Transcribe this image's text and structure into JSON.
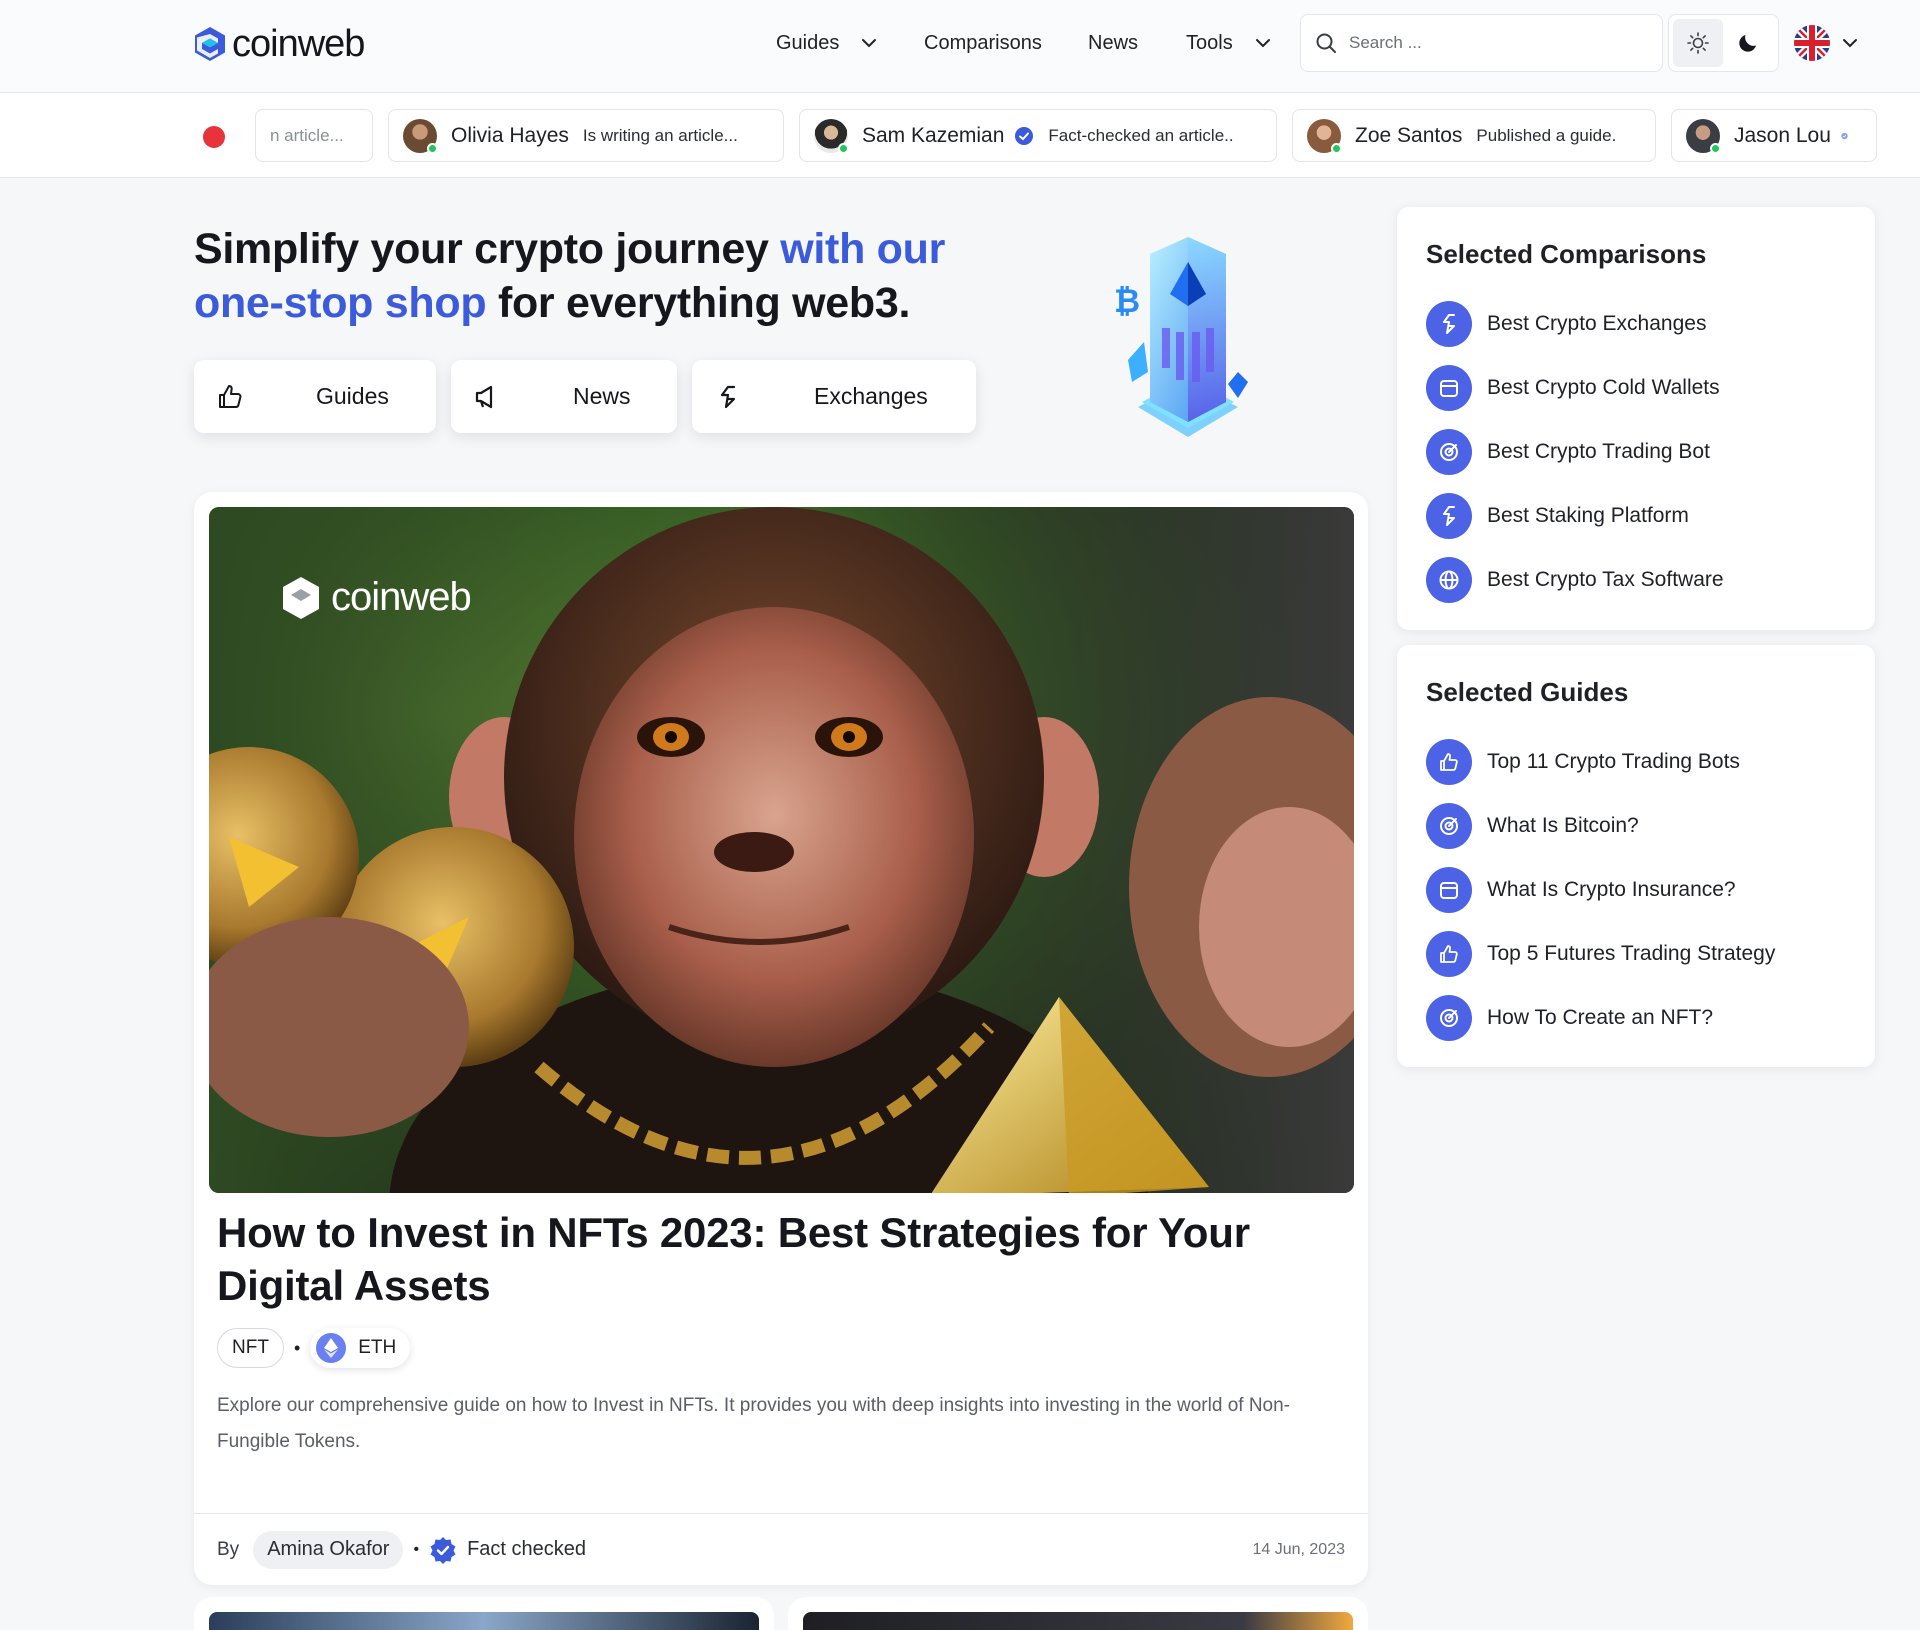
{
  "header": {
    "logo_text": "coinweb",
    "nav": {
      "guides": "Guides",
      "comparisons": "Comparisons",
      "news": "News",
      "tools": "Tools"
    },
    "search_placeholder": "Search ...",
    "theme_active": "light",
    "language_flag": "uk-flag"
  },
  "ticker": {
    "items": [
      {
        "name": "",
        "status": "n article...",
        "fade": true
      },
      {
        "name": "Olivia Hayes",
        "status": "Is writing an article...",
        "verified": false
      },
      {
        "name": "Sam Kazemian",
        "status": "Fact-checked an article..",
        "verified": true
      },
      {
        "name": "Zoe Santos",
        "status": "Published a guide.",
        "verified": false
      },
      {
        "name": "Jason Lou",
        "status": "",
        "verified": true
      }
    ]
  },
  "hero": {
    "title_part1": "Simplify your crypto journey ",
    "title_accent": "with our one-stop shop",
    "title_part2": " for everything web3.",
    "buttons": {
      "guides": "Guides",
      "news": "News",
      "exchanges": "Exchanges"
    }
  },
  "featured": {
    "image_logo_text": "coinweb",
    "title": "How to Invest in NFTs 2023: Best Strategies for Your Digital Assets",
    "tags": [
      "NFT",
      "ETH"
    ],
    "description": "Explore our comprehensive guide on how to Invest in NFTs. It provides you with deep insights into investing in the world of Non-Fungible Tokens.",
    "by_label": "By",
    "author": "Amina Okafor",
    "fact_checked": "Fact checked",
    "date": "14 Jun, 2023"
  },
  "sidebar": {
    "comparisons": {
      "title": "Selected Comparisons",
      "items": [
        {
          "label": "Best Crypto Exchanges",
          "icon": "exchange-icon"
        },
        {
          "label": "Best Crypto Cold Wallets",
          "icon": "wallet-icon"
        },
        {
          "label": "Best Crypto Trading Bot",
          "icon": "target-icon"
        },
        {
          "label": "Best Staking Platform",
          "icon": "exchange-icon"
        },
        {
          "label": "Best Crypto Tax Software",
          "icon": "globe-icon"
        }
      ]
    },
    "guides": {
      "title": "Selected Guides",
      "items": [
        {
          "label": "Top 11 Crypto Trading Bots",
          "icon": "thumbs-up-icon"
        },
        {
          "label": "What Is Bitcoin?",
          "icon": "target-icon"
        },
        {
          "label": "What Is Crypto Insurance?",
          "icon": "wallet-icon"
        },
        {
          "label": "Top 5 Futures Trading Strategy",
          "icon": "thumbs-up-icon"
        },
        {
          "label": "How To Create an NFT?",
          "icon": "target-icon"
        }
      ]
    }
  },
  "colors": {
    "accent": "#3b5bdb",
    "icon_bg": "#4c63e6",
    "live": "#e8333b",
    "online": "#22c55e"
  }
}
